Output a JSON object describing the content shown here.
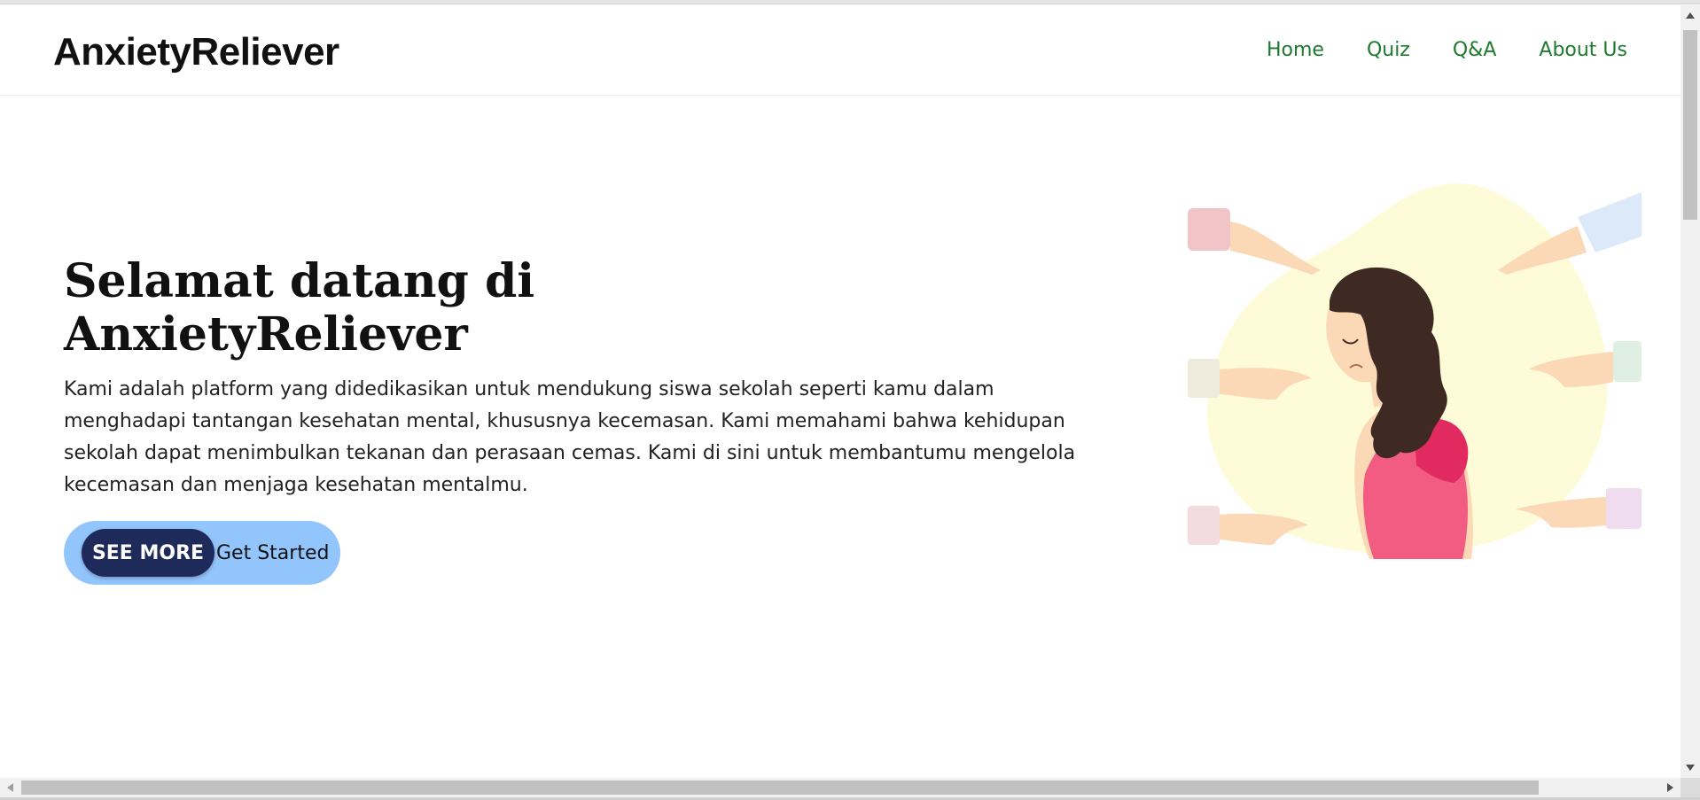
{
  "header": {
    "logo": "AnxietyReliever",
    "nav": [
      "Home",
      "Quiz",
      "Q&A",
      "About Us"
    ]
  },
  "hero": {
    "title": "Selamat datang di AnxietyReliever",
    "text": "Kami adalah platform yang didedikasikan untuk mendukung siswa sekolah seperti kamu dalam menghadapi tantangan kesehatan mental, khususnya kecemasan. Kami memahami bahwa kehidupan sekolah dapat menimbulkan tekanan dan perasaan cemas. Kami di sini untuk membantumu mengelola kecemasan dan menjaga kesehatan mentalmu.",
    "see_more_label": "SEE MORE",
    "get_started_label": "Get Started"
  },
  "colors": {
    "nav_link": "#1e7a2e",
    "cta_pill": "#93c5fd",
    "see_more_button": "#1e2a5a",
    "blob": "#fefcd8",
    "shirt": "#f25c83",
    "hair": "#3e2a22"
  },
  "illustration": {
    "subject": "sad woman surrounded by pointing hands"
  }
}
